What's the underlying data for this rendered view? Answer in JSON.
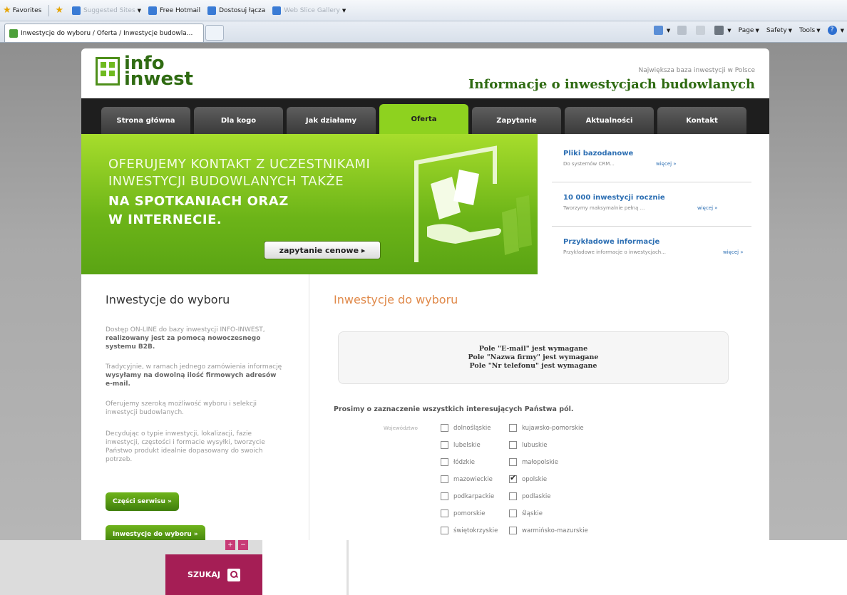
{
  "favorites_bar": {
    "favorites": "Favorites",
    "suggested_sites": "Suggested Sites",
    "free_hotmail": "Free Hotmail",
    "dostosuj": "Dostosuj łącza",
    "web_slice": "Web Slice Gallery"
  },
  "browser_tab": {
    "title": "Inwestycje do wyboru / Oferta / Inwestycje budowla..."
  },
  "command_bar": {
    "page": "Page",
    "safety": "Safety",
    "tools": "Tools",
    "help": "?"
  },
  "header": {
    "logo_line1": "info",
    "logo_line2": "inwest",
    "tagline_small": "Największa baza inwestycji w Polsce",
    "tagline_big": "Informacje o inwestycjach budowlanych"
  },
  "nav": [
    {
      "label": "Strona główna"
    },
    {
      "label": "Dla kogo"
    },
    {
      "label": "Jak działamy"
    },
    {
      "label": "Oferta"
    },
    {
      "label": "Zapytanie"
    },
    {
      "label": "Aktualności"
    },
    {
      "label": "Kontakt"
    }
  ],
  "banner": {
    "line1": "OFERUJEMY KONTAKT Z UCZESTNIKAMI",
    "line2": "INWESTYCJI BUDOWLANYCH TAKŻE",
    "line3": "NA SPOTKANIACH ORAZ",
    "line4": "W INTERNECIE.",
    "cta": "zapytanie cenowe ▸"
  },
  "side_items": [
    {
      "title": "Pliki bazodanowe",
      "desc": "Do systemów CRM...",
      "more": "więcej »"
    },
    {
      "title": "10 000 inwestycji rocznie",
      "desc": "Tworzymy maksymalnie pełną ...",
      "more": "więcej »"
    },
    {
      "title": "Przykładowe informacje",
      "desc": "Przykładowe informacje o inwestycjach...",
      "more": "więcej »"
    }
  ],
  "left": {
    "heading": "Inwestycje do wyboru",
    "p1_plain": "Dostęp ON-LINE do bazy inwestycji INFO-INWEST,",
    "p1_bold": "realizowany jest za pomocą nowoczesnego systemu B2B.",
    "p2_plain": "Tradycyjnie, w ramach jednego zamówienia informację",
    "p2_bold": "wysyłamy na dowolną ilość firmowych adresów e-mail.",
    "p3": "Oferujemy szeroką możliwość wyboru i selekcji inwestycji budowlanych.",
    "p4": "Decydując o typie inwestycji, lokalizacji, fazie inwestycji, częstości i formacie wysyłki, tworzycie Państwo produkt idealnie dopasowany do swoich potrzeb.",
    "btn1": "Części serwisu »",
    "btn2": "Inwestycje do wyboru »"
  },
  "right": {
    "heading": "Inwestycje do wyboru",
    "msg1": "Pole \"E-mail\" jest wymagane",
    "msg2": "Pole \"Nazwa firmy\" jest wymagane",
    "msg3": "Pole \"Nr telefonu\" jest wymagane",
    "prompt": "Prosimy o zaznaczenie wszystkich interesujących Państwa pól.",
    "voivodeship_label": "Województwo",
    "regions": [
      {
        "label": "dolnośląskie",
        "checked": false
      },
      {
        "label": "kujawsko-pomorskie",
        "checked": false
      },
      {
        "label": "lubelskie",
        "checked": false
      },
      {
        "label": "lubuskie",
        "checked": false
      },
      {
        "label": "łódzkie",
        "checked": false
      },
      {
        "label": "małopolskie",
        "checked": false
      },
      {
        "label": "mazowieckie",
        "checked": false
      },
      {
        "label": "opolskie",
        "checked": true
      },
      {
        "label": "podkarpackie",
        "checked": false
      },
      {
        "label": "podlaskie",
        "checked": false
      },
      {
        "label": "pomorskie",
        "checked": false
      },
      {
        "label": "śląskie",
        "checked": false
      },
      {
        "label": "świętokrzyskie",
        "checked": false
      },
      {
        "label": "warmińsko-mazurskie",
        "checked": false
      }
    ]
  },
  "lower": {
    "search_button": "SZUKAJ",
    "mini1": "+",
    "mini2": "−"
  },
  "colors": {
    "brand_green": "#6cb418",
    "nav_dark": "#1e1e1e",
    "accent_orange": "#e08a4b",
    "search_magenta": "#a51e55"
  }
}
